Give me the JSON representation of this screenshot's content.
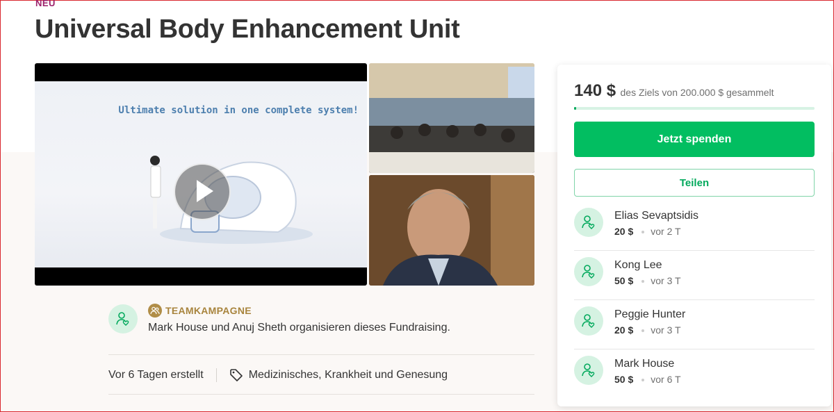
{
  "header": {
    "badge": "NEU",
    "title": "Universal Body Enhancement Unit"
  },
  "media": {
    "main_caption": "Ultimate solution in one complete system!",
    "play_icon": "play-icon"
  },
  "organizer": {
    "team_label": "TEAMKAMPAGNE",
    "text": "Mark House und Anuj Sheth organisieren dieses Fundraising."
  },
  "meta": {
    "created": "Vor 6 Tagen erstellt",
    "category": "Medizinisches, Krankheit und Genesung"
  },
  "donation_panel": {
    "raised": "140 $",
    "goal_text": "des Ziels von 200.000 $ gesammelt",
    "progress_fraction": 0.0007,
    "donate_label": "Jetzt spenden",
    "share_label": "Teilen",
    "donors": [
      {
        "name": "Elias Sevaptsidis",
        "amount": "20 $",
        "time": "vor 2 T"
      },
      {
        "name": "Kong Lee",
        "amount": "50 $",
        "time": "vor 3 T"
      },
      {
        "name": "Peggie Hunter",
        "amount": "20 $",
        "time": "vor 3 T"
      },
      {
        "name": "Mark House",
        "amount": "50 $",
        "time": "vor 6 T"
      }
    ]
  },
  "colors": {
    "accent_green": "#02be61",
    "team_gold": "#a8843d",
    "badge_purple": "#9b1f6b"
  }
}
